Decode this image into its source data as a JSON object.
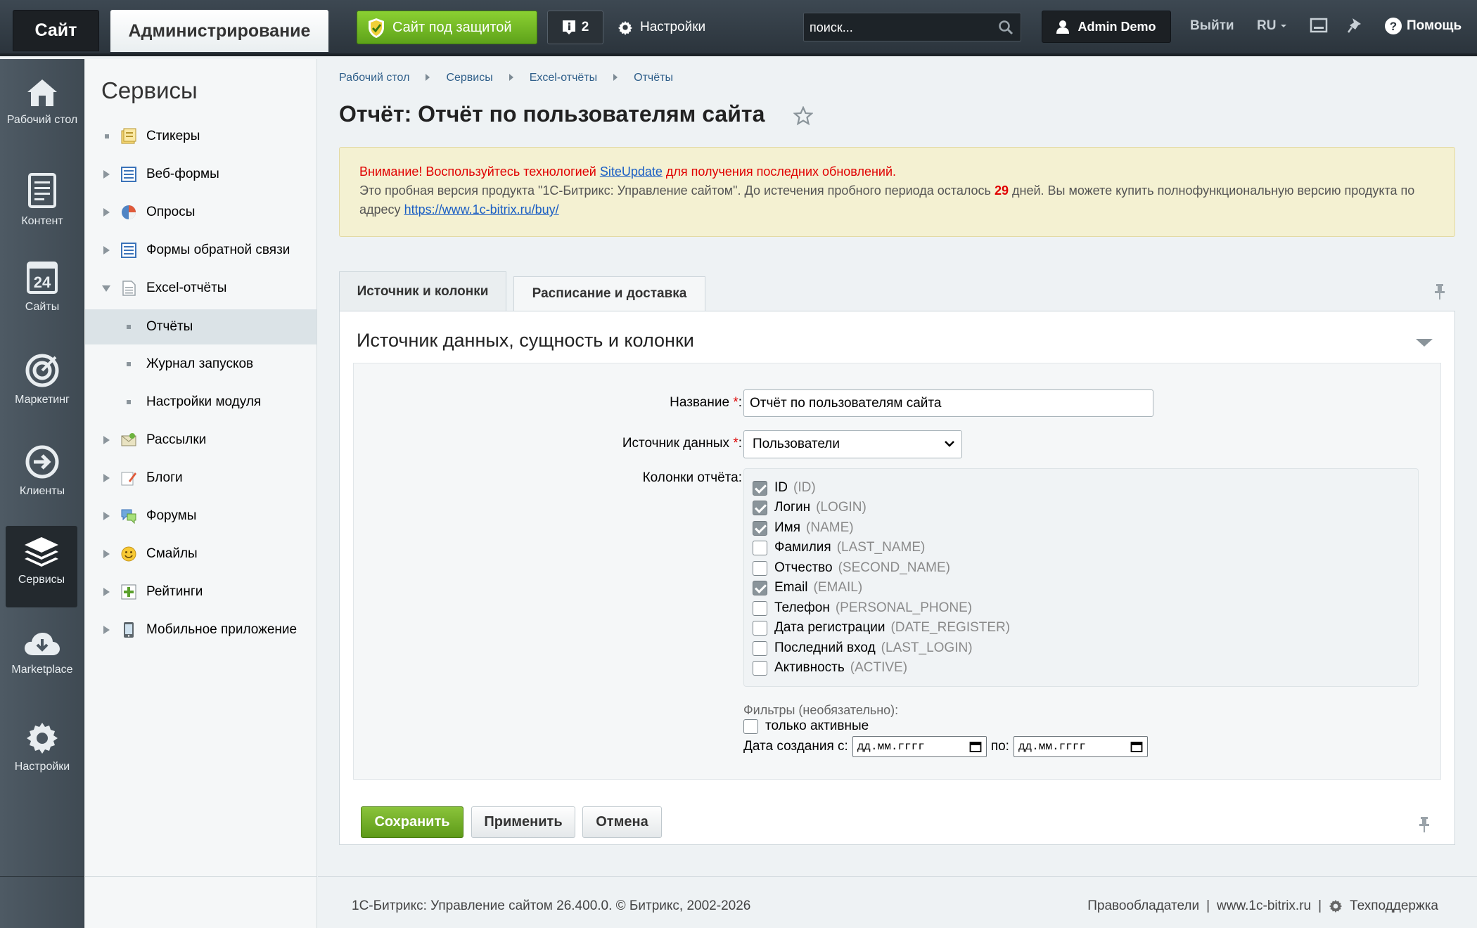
{
  "topbar": {
    "site_tab": "Сайт",
    "admin_tab": "Администрирование",
    "protect_button": "Сайт под защитой",
    "notifications_count": "2",
    "settings_label": "Настройки",
    "search_placeholder": "поиск...",
    "user_name": "Admin Demo",
    "logout_label": "Выйти",
    "language": "RU",
    "help_label": "Помощь"
  },
  "leftmenu": {
    "items": [
      {
        "label": "Рабочий стол",
        "icon": "home-icon"
      },
      {
        "label": "Контент",
        "icon": "document-icon"
      },
      {
        "label": "Сайты",
        "icon": "calendar-icon"
      },
      {
        "label": "Маркетинг",
        "icon": "target-icon"
      },
      {
        "label": "Клиенты",
        "icon": "arrow-circle-icon"
      },
      {
        "label": "Сервисы",
        "icon": "layers-icon"
      },
      {
        "label": "Marketplace",
        "icon": "cloud-download-icon"
      },
      {
        "label": "Настройки",
        "icon": "gear-icon"
      }
    ],
    "calendar_number": "24"
  },
  "submenu": {
    "title": "Сервисы",
    "items": [
      {
        "label": "Стикеры"
      },
      {
        "label": "Веб-формы"
      },
      {
        "label": "Опросы"
      },
      {
        "label": "Формы обратной связи"
      },
      {
        "label": "Excel-отчёты"
      },
      {
        "label": "Отчёты"
      },
      {
        "label": "Журнал запусков"
      },
      {
        "label": "Настройки модуля"
      },
      {
        "label": "Рассылки"
      },
      {
        "label": "Блоги"
      },
      {
        "label": "Форумы"
      },
      {
        "label": "Смайлы"
      },
      {
        "label": "Рейтинги"
      },
      {
        "label": "Мобильное приложение"
      }
    ]
  },
  "breadcrumb": [
    "Рабочий стол",
    "Сервисы",
    "Excel-отчёты",
    "Отчёты"
  ],
  "page_title": "Отчёт: Отчёт по пользователям сайта",
  "notice": {
    "warn_prefix": "Внимание! Воспользуйтесь технологией",
    "link_siteupdate": "SiteUpdate",
    "warn_suffix": "для получения последних обновлений.",
    "trial_text_1": "Это пробная версия продукта \"1С-Битрикс: Управление сайтом\". До истечения пробного периода осталось",
    "days": "29",
    "trial_text_2": "дней. Вы можете купить полнофункциональную версию продукта по адресу",
    "buy_link": "https://www.1c-bitrix.ru/buy/"
  },
  "tabs": [
    {
      "label": "Источник и колонки"
    },
    {
      "label": "Расписание и доставка"
    }
  ],
  "panel": {
    "title": "Источник данных, сущность и колонки",
    "name_label": "Название",
    "name_value": "Отчёт по пользователям сайта",
    "source_label": "Источник данных",
    "source_value": "Пользователи",
    "columns_label": "Колонки отчёта:",
    "columns": [
      {
        "label": "ID",
        "code": "(ID)",
        "checked": true
      },
      {
        "label": "Логин",
        "code": "(LOGIN)",
        "checked": true
      },
      {
        "label": "Имя",
        "code": "(NAME)",
        "checked": true
      },
      {
        "label": "Фамилия",
        "code": "(LAST_NAME)",
        "checked": false
      },
      {
        "label": "Отчество",
        "code": "(SECOND_NAME)",
        "checked": false
      },
      {
        "label": "Email",
        "code": "(EMAIL)",
        "checked": true
      },
      {
        "label": "Телефон",
        "code": "(PERSONAL_PHONE)",
        "checked": false
      },
      {
        "label": "Дата регистрации",
        "code": "(DATE_REGISTER)",
        "checked": false
      },
      {
        "label": "Последний вход",
        "code": "(LAST_LOGIN)",
        "checked": false
      },
      {
        "label": "Активность",
        "code": "(ACTIVE)",
        "checked": false
      }
    ],
    "filters_title": "Фильтры (необязательно):",
    "filter_active_label": "только активные",
    "date_from_label": "Дата создания с:",
    "date_to_label": "по:",
    "date_placeholder": "дд.мм.гггг"
  },
  "buttons": {
    "save": "Сохранить",
    "apply": "Применить",
    "cancel": "Отмена"
  },
  "footer": {
    "copyright": "1С-Битрикс: Управление сайтом 26.400.0. © Битрикс, 2002-2026",
    "rights": "Правообладатели",
    "sep1": "|",
    "website": "www.1c-bitrix.ru",
    "sep2": "|",
    "support": "Техподдержка"
  }
}
